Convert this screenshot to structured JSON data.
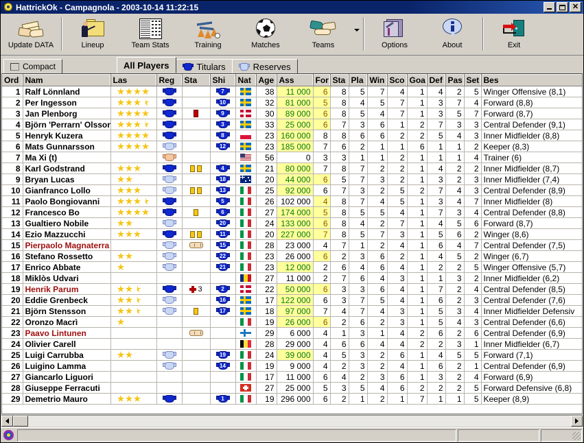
{
  "window": {
    "title": "HattrickOk - Campagnola - 2003-10-14 11:22:15",
    "minimize_label": "",
    "maximize_label": "",
    "close_label": "✕"
  },
  "toolbar": {
    "items": [
      {
        "label": "Update DATA",
        "icon": "handshake-envelope-icon"
      },
      {
        "label": "Lineup",
        "icon": "lineup-folder-icon"
      },
      {
        "label": "Team Stats",
        "icon": "team-stats-table-icon"
      },
      {
        "label": "Training",
        "icon": "training-cones-icon"
      },
      {
        "label": "Matches",
        "icon": "soccer-ball-icon"
      },
      {
        "label": "Teams",
        "icon": "handshake-icon"
      },
      {
        "label": "Options",
        "icon": "options-tools-icon"
      },
      {
        "label": "About",
        "icon": "about-info-icon"
      },
      {
        "label": "Exit",
        "icon": "exit-door-icon"
      }
    ]
  },
  "tabs": {
    "compact": "Compact",
    "items": [
      {
        "label": "All Players",
        "icon": "none",
        "selected": true
      },
      {
        "label": "Titulars",
        "icon": "shirt-dark-icon",
        "selected": false
      },
      {
        "label": "Reserves",
        "icon": "shirt-light-icon",
        "selected": false
      }
    ]
  },
  "grid": {
    "columns": [
      "Ord",
      "Nam",
      "Las",
      "Reg",
      "Sta",
      "Shi",
      "Nat",
      "Age",
      "Ass",
      "For",
      "Sta",
      "Pla",
      "Win",
      "Sco",
      "Goa",
      "Def",
      "Pas",
      "Set",
      "Bes"
    ],
    "rows": [
      {
        "ord": "1",
        "nam": "Ralf Lönnland",
        "red": false,
        "stars": 4,
        "reg": "dark",
        "sta": "",
        "shi": "7",
        "nat": "se",
        "age": "38",
        "ass": "11 000",
        "ass_hl": true,
        "for": "6",
        "for_hl": true,
        "sta2": "8",
        "pla": "5",
        "win": "7",
        "sco": "4",
        "goa": "1",
        "def": "4",
        "pas": "2",
        "set": "5",
        "bes": "Winger Offensive (8,1)"
      },
      {
        "ord": "2",
        "nam": "Per Ingesson",
        "red": false,
        "stars": 3.5,
        "reg": "dark",
        "sta": "",
        "shi": "10",
        "nat": "se",
        "age": "32",
        "ass": "81 000",
        "ass_hl": true,
        "for": "5",
        "for_hl": true,
        "sta2": "8",
        "pla": "4",
        "win": "5",
        "sco": "7",
        "goa": "1",
        "def": "3",
        "pas": "7",
        "set": "4",
        "bes": "Forward (8,8)"
      },
      {
        "ord": "3",
        "nam": "Jan Plenborg",
        "red": false,
        "stars": 4,
        "reg": "dark",
        "sta": "red",
        "shi": "9",
        "nat": "dk",
        "age": "30",
        "ass": "89 000",
        "ass_hl": true,
        "for": "6",
        "for_hl": true,
        "sta2": "8",
        "pla": "5",
        "win": "4",
        "sco": "7",
        "goa": "1",
        "def": "3",
        "pas": "5",
        "set": "7",
        "bes": "Forward (8,7)"
      },
      {
        "ord": "4",
        "nam": "Björn 'Perrarn' Olsson",
        "red": false,
        "stars": 3.5,
        "reg": "dark",
        "sta": "",
        "shi": "3",
        "nat": "se",
        "age": "33",
        "ass": "25 000",
        "ass_hl": true,
        "for": "6",
        "for_hl": true,
        "sta2": "7",
        "pla": "3",
        "win": "6",
        "sco": "1",
        "goa": "2",
        "def": "7",
        "pas": "3",
        "set": "3",
        "bes": "Central Defender (9,1)"
      },
      {
        "ord": "5",
        "nam": "Henryk Kuzera",
        "red": false,
        "stars": 4,
        "reg": "dark",
        "sta": "",
        "shi": "8",
        "nat": "pl",
        "age": "23",
        "ass": "160 000",
        "ass_hl": true,
        "for": "8",
        "for_hl": false,
        "sta2": "8",
        "pla": "6",
        "win": "6",
        "sco": "2",
        "goa": "2",
        "def": "5",
        "pas": "4",
        "set": "3",
        "bes": "Inner Midfielder (8,8)"
      },
      {
        "ord": "6",
        "nam": "Mats Gunnarsson",
        "red": false,
        "stars": 4,
        "reg": "light",
        "sta": "",
        "shi": "12",
        "nat": "se",
        "age": "23",
        "ass": "185 000",
        "ass_hl": true,
        "for": "7",
        "for_hl": false,
        "sta2": "6",
        "pla": "2",
        "win": "1",
        "sco": "1",
        "goa": "6",
        "def": "1",
        "pas": "1",
        "set": "2",
        "bes": "Keeper (8,3)"
      },
      {
        "ord": "7",
        "nam": "Ma Xi (t)",
        "red": false,
        "stars": 0,
        "reg": "skin",
        "sta": "",
        "shi": "",
        "nat": "us",
        "age": "56",
        "ass": "0",
        "ass_hl": false,
        "for": "3",
        "for_hl": false,
        "sta2": "3",
        "pla": "1",
        "win": "1",
        "sco": "2",
        "goa": "1",
        "def": "1",
        "pas": "1",
        "set": "4",
        "bes": "Trainer (6)"
      },
      {
        "ord": "8",
        "nam": "Karl Godstrand",
        "red": false,
        "stars": 3,
        "reg": "dark",
        "sta": "yy",
        "shi": "4",
        "nat": "se",
        "age": "21",
        "ass": "80 000",
        "ass_hl": true,
        "for": "7",
        "for_hl": false,
        "sta2": "8",
        "pla": "7",
        "win": "2",
        "sco": "2",
        "goa": "1",
        "def": "4",
        "pas": "2",
        "set": "2",
        "bes": "Inner Midfielder (8,7)"
      },
      {
        "ord": "9",
        "nam": "Bryan Lucas",
        "red": false,
        "stars": 2,
        "reg": "light",
        "sta": "",
        "shi": "18",
        "nat": "au",
        "age": "20",
        "ass": "44 000",
        "ass_hl": true,
        "for": "6",
        "for_hl": true,
        "sta2": "5",
        "pla": "7",
        "win": "3",
        "sco": "2",
        "goa": "1",
        "def": "3",
        "pas": "2",
        "set": "3",
        "bes": "Inner Midfielder (7,4)"
      },
      {
        "ord": "10",
        "nam": "Gianfranco Lollo",
        "red": false,
        "stars": 3,
        "reg": "light",
        "sta": "yy",
        "shi": "13",
        "nat": "it",
        "age": "25",
        "ass": "92 000",
        "ass_hl": true,
        "for": "6",
        "for_hl": false,
        "sta2": "7",
        "pla": "3",
        "win": "2",
        "sco": "5",
        "goa": "2",
        "def": "7",
        "pas": "4",
        "set": "3",
        "bes": "Central Defender (8,9)"
      },
      {
        "ord": "11",
        "nam": "Paolo Bongiovanni",
        "red": false,
        "stars": 3.5,
        "reg": "dark",
        "sta": "",
        "shi": "5",
        "nat": "it",
        "age": "26",
        "ass": "102 000",
        "ass_hl": false,
        "for": "4",
        "for_hl": true,
        "sta2": "8",
        "pla": "7",
        "win": "4",
        "sco": "5",
        "goa": "1",
        "def": "3",
        "pas": "4",
        "set": "7",
        "bes": "Inner Midfielder (8)"
      },
      {
        "ord": "12",
        "nam": "Francesco Bo",
        "red": false,
        "stars": 4,
        "reg": "dark",
        "sta": "y",
        "shi": "6",
        "nat": "it",
        "age": "27",
        "ass": "174 000",
        "ass_hl": true,
        "for": "5",
        "for_hl": true,
        "sta2": "8",
        "pla": "5",
        "win": "5",
        "sco": "4",
        "goa": "1",
        "def": "7",
        "pas": "3",
        "set": "4",
        "bes": "Central Defender (8,8)"
      },
      {
        "ord": "13",
        "nam": "Gualtiero Nobile",
        "red": false,
        "stars": 2,
        "reg": "light",
        "sta": "",
        "shi": "20",
        "nat": "it",
        "age": "24",
        "ass": "133 000",
        "ass_hl": true,
        "for": "6",
        "for_hl": true,
        "sta2": "8",
        "pla": "4",
        "win": "2",
        "sco": "7",
        "goa": "1",
        "def": "4",
        "pas": "5",
        "set": "6",
        "bes": "Forward (8,7)"
      },
      {
        "ord": "14",
        "nam": "Ezio Mazzucchi",
        "red": false,
        "stars": 3,
        "reg": "dark",
        "sta": "yy",
        "shi": "11",
        "nat": "it",
        "age": "20",
        "ass": "227 000",
        "ass_hl": true,
        "for": "7",
        "for_hl": true,
        "sta2": "8",
        "pla": "5",
        "win": "7",
        "sco": "3",
        "goa": "1",
        "def": "5",
        "pas": "6",
        "set": "2",
        "bes": "Winger (8,6)"
      },
      {
        "ord": "15",
        "nam": "Pierpaolo Magnaterra",
        "red": true,
        "stars": 0,
        "reg": "light",
        "sta": "bandage",
        "shi": "15",
        "nat": "it",
        "age": "28",
        "ass": "23 000",
        "ass_hl": false,
        "for": "4",
        "for_hl": false,
        "sta2": "7",
        "pla": "1",
        "win": "2",
        "sco": "4",
        "goa": "1",
        "def": "6",
        "pas": "4",
        "set": "7",
        "bes": "Central Defender (7,5)"
      },
      {
        "ord": "16",
        "nam": "Stefano Rossetto",
        "red": false,
        "stars": 2,
        "reg": "light",
        "sta": "",
        "shi": "22",
        "nat": "it",
        "age": "23",
        "ass": "26 000",
        "ass_hl": false,
        "for": "6",
        "for_hl": true,
        "sta2": "2",
        "pla": "3",
        "win": "6",
        "sco": "2",
        "goa": "1",
        "def": "4",
        "pas": "5",
        "set": "2",
        "bes": "Winger (6,7)"
      },
      {
        "ord": "17",
        "nam": "Enrico Abbate",
        "red": false,
        "stars": 1,
        "reg": "light",
        "sta": "",
        "shi": "21",
        "nat": "it",
        "age": "23",
        "ass": "12 000",
        "ass_hl": true,
        "for": "2",
        "for_hl": false,
        "sta2": "6",
        "pla": "4",
        "win": "6",
        "sco": "4",
        "goa": "1",
        "def": "2",
        "pas": "2",
        "set": "5",
        "bes": "Winger Offensive (5,7)"
      },
      {
        "ord": "18",
        "nam": "Miklòs Udvari",
        "red": false,
        "stars": 0,
        "reg": "",
        "sta": "",
        "shi": "",
        "nat": "ro",
        "age": "27",
        "ass": "11 000",
        "ass_hl": false,
        "for": "2",
        "for_hl": false,
        "sta2": "7",
        "pla": "6",
        "win": "4",
        "sco": "3",
        "goa": "1",
        "def": "1",
        "pas": "3",
        "set": "2",
        "bes": "Inner Midfielder (6,2)"
      },
      {
        "ord": "19",
        "nam": "Henrik Parum",
        "red": true,
        "stars": 2.5,
        "reg": "dark",
        "sta": "plus3",
        "shi": "2",
        "nat": "dk",
        "age": "22",
        "ass": "50 000",
        "ass_hl": true,
        "for": "6",
        "for_hl": true,
        "sta2": "3",
        "pla": "3",
        "win": "6",
        "sco": "4",
        "goa": "1",
        "def": "7",
        "pas": "2",
        "set": "4",
        "bes": "Central Defender (8,5)"
      },
      {
        "ord": "20",
        "nam": "Eddie Grenbeck",
        "red": false,
        "stars": 2.5,
        "reg": "light",
        "sta": "",
        "shi": "16",
        "nat": "se",
        "age": "17",
        "ass": "122 000",
        "ass_hl": true,
        "for": "6",
        "for_hl": false,
        "sta2": "3",
        "pla": "7",
        "win": "5",
        "sco": "4",
        "goa": "1",
        "def": "6",
        "pas": "2",
        "set": "3",
        "bes": "Central Defender (7,6)"
      },
      {
        "ord": "21",
        "nam": "Björn Stensson",
        "red": false,
        "stars": 2.5,
        "reg": "light",
        "sta": "y",
        "shi": "17",
        "nat": "se",
        "age": "18",
        "ass": "97 000",
        "ass_hl": true,
        "for": "7",
        "for_hl": false,
        "sta2": "4",
        "pla": "7",
        "win": "4",
        "sco": "3",
        "goa": "1",
        "def": "5",
        "pas": "3",
        "set": "4",
        "bes": "Inner Midfielder Defensiv"
      },
      {
        "ord": "22",
        "nam": "Oronzo Macrì",
        "red": false,
        "stars": 1,
        "reg": "",
        "sta": "",
        "shi": "",
        "nat": "it",
        "age": "19",
        "ass": "26 000",
        "ass_hl": true,
        "for": "6",
        "for_hl": true,
        "sta2": "2",
        "pla": "6",
        "win": "2",
        "sco": "3",
        "goa": "1",
        "def": "5",
        "pas": "4",
        "set": "3",
        "bes": "Central Defender (6,6)"
      },
      {
        "ord": "23",
        "nam": "Paavo Lintunen",
        "red": true,
        "stars": 0,
        "reg": "",
        "sta": "bandage",
        "shi": "",
        "nat": "fi",
        "age": "29",
        "ass": "6 000",
        "ass_hl": false,
        "for": "4",
        "for_hl": false,
        "sta2": "1",
        "pla": "3",
        "win": "1",
        "sco": "4",
        "goa": "2",
        "def": "6",
        "pas": "2",
        "set": "6",
        "bes": "Central Defender (6,9)"
      },
      {
        "ord": "24",
        "nam": "Olivier Carell",
        "red": false,
        "stars": 0,
        "reg": "",
        "sta": "",
        "shi": "",
        "nat": "be",
        "age": "28",
        "ass": "29 000",
        "ass_hl": false,
        "for": "4",
        "for_hl": false,
        "sta2": "6",
        "pla": "6",
        "win": "4",
        "sco": "4",
        "goa": "2",
        "def": "2",
        "pas": "3",
        "set": "1",
        "bes": "Inner Midfielder (6,7)"
      },
      {
        "ord": "25",
        "nam": "Luigi Carrubba",
        "red": false,
        "stars": 2,
        "reg": "light",
        "sta": "",
        "shi": "19",
        "nat": "it",
        "age": "24",
        "ass": "39 000",
        "ass_hl": true,
        "for": "4",
        "for_hl": false,
        "sta2": "5",
        "pla": "3",
        "win": "2",
        "sco": "6",
        "goa": "1",
        "def": "4",
        "pas": "5",
        "set": "5",
        "bes": "Forward (7,1)"
      },
      {
        "ord": "26",
        "nam": "Luigino Lamma",
        "red": false,
        "stars": 0,
        "reg": "light",
        "sta": "",
        "shi": "14",
        "nat": "it",
        "age": "19",
        "ass": "9 000",
        "ass_hl": false,
        "for": "4",
        "for_hl": false,
        "sta2": "2",
        "pla": "3",
        "win": "2",
        "sco": "4",
        "goa": "1",
        "def": "6",
        "pas": "2",
        "set": "1",
        "bes": "Central Defender (6,9)"
      },
      {
        "ord": "27",
        "nam": "Giancarlo Liguori",
        "red": false,
        "stars": 0,
        "reg": "",
        "sta": "",
        "shi": "",
        "nat": "it",
        "age": "17",
        "ass": "11 000",
        "ass_hl": false,
        "for": "6",
        "for_hl": false,
        "sta2": "4",
        "pla": "2",
        "win": "3",
        "sco": "6",
        "goa": "1",
        "def": "3",
        "pas": "2",
        "set": "4",
        "bes": "Forward (6,9)"
      },
      {
        "ord": "28",
        "nam": "Giuseppe Ferracuti",
        "red": false,
        "stars": 0,
        "reg": "",
        "sta": "",
        "shi": "",
        "nat": "ch",
        "age": "27",
        "ass": "25 000",
        "ass_hl": false,
        "for": "5",
        "for_hl": false,
        "sta2": "3",
        "pla": "5",
        "win": "4",
        "sco": "6",
        "goa": "2",
        "def": "2",
        "pas": "2",
        "set": "5",
        "bes": "Forward Defensive (6,8)"
      },
      {
        "ord": "29",
        "nam": "Demetrio Mauro",
        "red": false,
        "stars": 3,
        "reg": "dark",
        "sta": "",
        "shi": "1",
        "nat": "it",
        "age": "19",
        "ass": "296 000",
        "ass_hl": false,
        "for": "6",
        "for_hl": false,
        "sta2": "2",
        "pla": "1",
        "win": "2",
        "sco": "1",
        "goa": "7",
        "def": "1",
        "pas": "1",
        "set": "5",
        "bes": "Keeper (8,9)"
      }
    ]
  },
  "statusbar": {
    "panel1": "",
    "panel2": "",
    "panel3": ""
  },
  "colors": {
    "titlebar": "#0a246a",
    "face": "#d4d0c8",
    "highlight_cell": "#ffff9c",
    "money_green": "#0a7a0a",
    "name_red": "#a01010"
  }
}
